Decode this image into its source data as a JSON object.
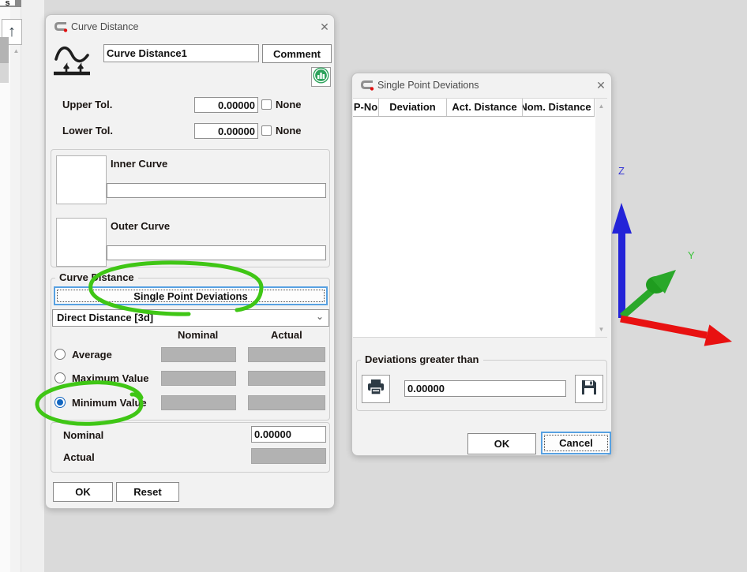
{
  "left_panel": {
    "fragment_text": "s",
    "up_arrow_glyph": "↑",
    "scroll_up_glyph": "▲"
  },
  "curve_dialog": {
    "title": "Curve Distance",
    "close_glyph": "✕",
    "name_value": "Curve Distance1",
    "comment_label": "Comment",
    "upper_tol": {
      "label": "Upper Tol.",
      "value": "0.00000",
      "none_label": "None",
      "none_checked": false
    },
    "lower_tol": {
      "label": "Lower Tol.",
      "value": "0.00000",
      "none_label": "None",
      "none_checked": false
    },
    "inner_curve": {
      "label": "Inner Curve",
      "value": ""
    },
    "outer_curve": {
      "label": "Outer Curve",
      "value": ""
    },
    "group_label": "Curve Distance",
    "spd_button_label": "Single Point Deviations",
    "distance_mode_value": "Direct Distance [3d]",
    "chevron_glyph": "⌄",
    "col_nominal": "Nominal",
    "col_actual": "Actual",
    "radios": [
      {
        "label": "Average",
        "selected": false
      },
      {
        "label": "Maximum Value",
        "selected": false
      },
      {
        "label": "Minimum Value",
        "selected": true
      }
    ],
    "nominal_row": {
      "label": "Nominal",
      "value": "0.00000"
    },
    "actual_row": {
      "label": "Actual"
    },
    "ok_label": "OK",
    "reset_label": "Reset"
  },
  "spd_dialog": {
    "title": "Single Point Deviations",
    "close_glyph": "✕",
    "columns": [
      "P-No",
      "Deviation",
      "Act. Distance",
      "Nom. Distance"
    ],
    "rows": [],
    "scroll_up_glyph": "▲",
    "scroll_down_glyph": "▼",
    "dev_group": {
      "label": "Deviations greater than",
      "value": "0.00000"
    },
    "ok_label": "OK",
    "cancel_label": "Cancel"
  },
  "axis_triad": {
    "z_label": "Z",
    "y_label": "Y",
    "colors": {
      "z_arrow": "#2323d8",
      "y_arrow": "#2aa82a",
      "x_arrow": "#e81111",
      "z_text": "#3535d6",
      "y_text": "#3cc43c"
    }
  },
  "annotations": {
    "color": "#3fc615",
    "items": [
      "circle-around-single-point-deviations-button",
      "circle-around-minimum-value-radio"
    ]
  },
  "icons": {
    "app_logo": "calypso-logo-icon",
    "curve": "curve-distance-icon",
    "histogram": "histogram-icon",
    "printer": "printer-icon",
    "save": "floppy-save-icon"
  }
}
